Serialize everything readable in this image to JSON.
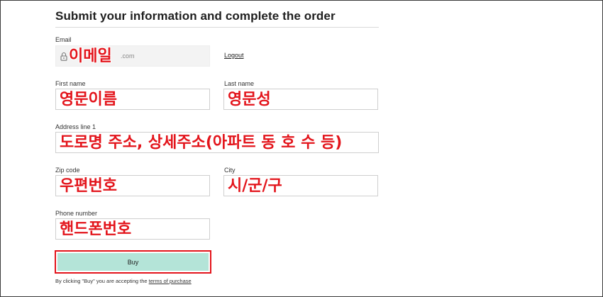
{
  "form": {
    "title": "Submit your information and complete the order",
    "email": {
      "label": "Email",
      "value_suffix": ".com",
      "annotation": "이메일"
    },
    "logout_label": "Logout",
    "first_name": {
      "label": "First name",
      "annotation": "영문이름"
    },
    "last_name": {
      "label": "Last name",
      "annotation": "영문성"
    },
    "address": {
      "label": "Address line 1",
      "annotation": "도로명 주소, 상세주소(아파트 동 호 수 등)"
    },
    "zip": {
      "label": "Zip code",
      "annotation": "우편번호"
    },
    "city": {
      "label": "City",
      "annotation": "시/군/구"
    },
    "phone": {
      "label": "Phone number",
      "annotation": "핸드폰번호"
    },
    "buy_label": "Buy",
    "terms_prefix": "By clicking \"Buy\" you are accepting the",
    "terms_link": "terms of purchase"
  },
  "colors": {
    "annotation": "#e3141b",
    "buy_button": "#b4e4d8",
    "field_border": "#cfcfcf"
  },
  "icons": {
    "email_field": "lock-icon"
  }
}
